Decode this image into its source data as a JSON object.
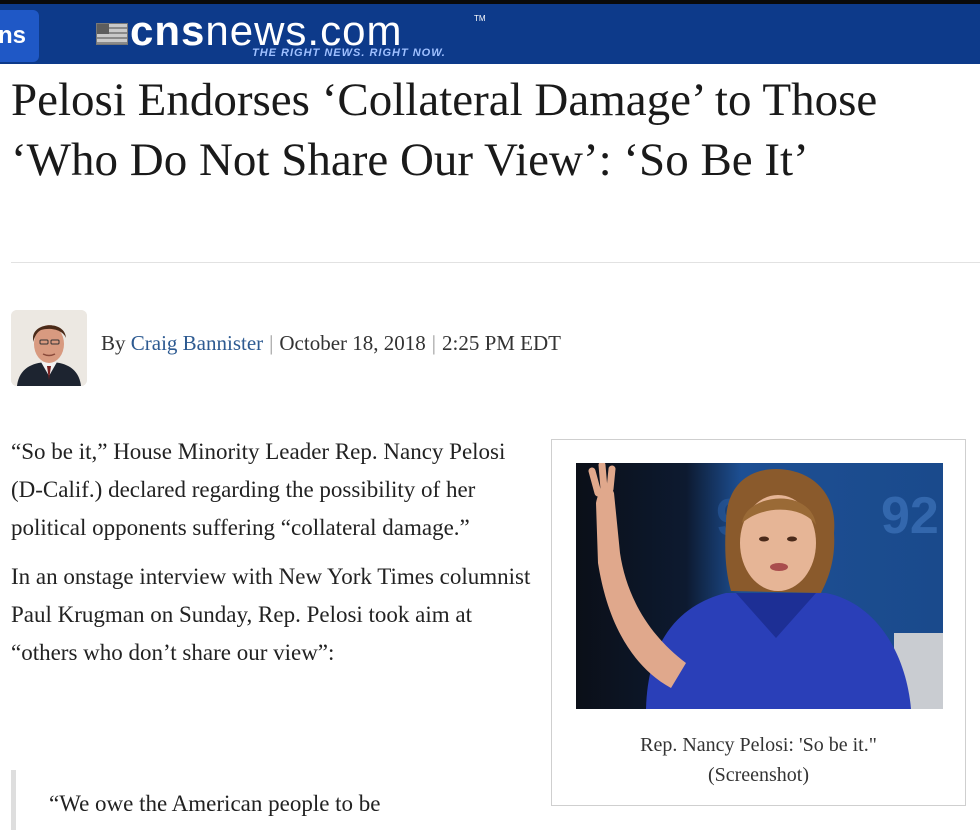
{
  "header": {
    "tab_label": "ns",
    "logo_bold": "cns",
    "logo_light": "news.com",
    "trademark": "TM",
    "tagline": "THE RIGHT NEWS. RIGHT NOW.",
    "colors": {
      "bar": "#0d3a8a",
      "tab": "#1f58c6",
      "tagline": "#9fc0ff"
    }
  },
  "article": {
    "headline": "Pelosi Endorses ‘Collateral Damage’ to Those ‘Who Do Not Share Our View’: ‘So Be It’",
    "byline": {
      "prefix": "By",
      "author": "Craig Bannister",
      "date": "October 18, 2018",
      "time": "2:25 PM EDT",
      "author_color": "#2d5a91"
    },
    "paragraphs": [
      "“So be it,” House Minority Leader Rep. Nancy Pelosi (D-Calif.) declared regarding the possibility of her political opponents suffering “collateral damage.”",
      "In an onstage interview with New York Times columnist Paul Krugman on Sunday, Rep. Pelosi took aim at “others who don’t share our view”:"
    ],
    "blockquote": "“We owe the American people to be",
    "figure": {
      "caption_line1": "Rep. Nancy Pelosi: 'So be it.\"",
      "caption_line2": "(Screenshot)",
      "background_text": "92"
    }
  }
}
